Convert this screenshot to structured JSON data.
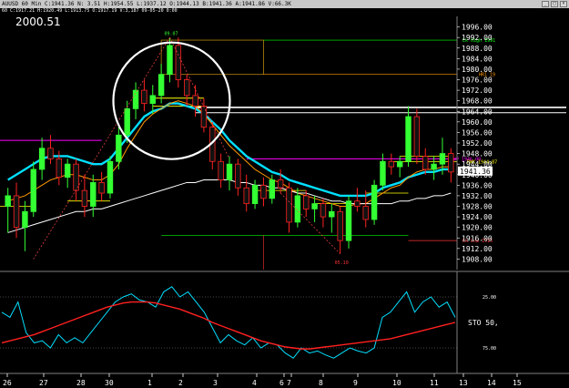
{
  "window": {
    "title": "AUUSD 60 Min  C:1941.36  N:  3.51  H:1954.55  L:1937.12  O:1944.13  B:1941.36  A:1941.86  V:66.3K"
  },
  "info_line": "60  C:1917.21  H:1920.49  L:1913.75  O:1917.19  V:3,187  09-05-20  0:00",
  "current_price_label": "2000.51",
  "chart_data": [
    {
      "type": "candlestick",
      "title": "",
      "y_axis": {
        "range": [
          1904,
          2000
        ],
        "ticks": [
          1908,
          1912,
          1916,
          1920,
          1924,
          1928,
          1932,
          1936,
          1940,
          1944,
          1948,
          1952,
          1956,
          1960,
          1964,
          1968,
          1972,
          1976,
          1980,
          1984,
          1988,
          1992,
          1996
        ],
        "tick_labels": [
          "1908.00",
          "1912.00",
          "1916.00",
          "1920.00",
          "1924.00",
          "1928.00",
          "1932.00",
          "1936.00",
          "1940.00",
          "1944.00",
          "1948.00",
          "1952.00",
          "1956.00",
          "1960.00",
          "1964.00",
          "1968.00",
          "1972.00",
          "1976.00",
          "1980.00",
          "1984.00",
          "1988.00",
          "1992.00",
          "1996.00"
        ],
        "last_price_tag": "1941.36"
      },
      "x_axis": {
        "tick_labels": [
          "26",
          "27",
          "28",
          "30",
          "1",
          "2",
          "3",
          "4",
          "6",
          "7",
          "8",
          "9",
          "10",
          "11",
          "13",
          "14",
          "15"
        ]
      },
      "candles": [
        {
          "o": 1928,
          "h": 1935,
          "l": 1918,
          "c": 1932
        },
        {
          "o": 1932,
          "h": 1937,
          "l": 1916,
          "c": 1920
        },
        {
          "o": 1920,
          "h": 1930,
          "l": 1911,
          "c": 1926
        },
        {
          "o": 1926,
          "h": 1945,
          "l": 1924,
          "c": 1942
        },
        {
          "o": 1942,
          "h": 1954,
          "l": 1938,
          "c": 1950
        },
        {
          "o": 1950,
          "h": 1955,
          "l": 1944,
          "c": 1946
        },
        {
          "o": 1946,
          "h": 1949,
          "l": 1936,
          "c": 1939
        },
        {
          "o": 1939,
          "h": 1946,
          "l": 1935,
          "c": 1944
        },
        {
          "o": 1944,
          "h": 1946,
          "l": 1930,
          "c": 1934
        },
        {
          "o": 1934,
          "h": 1940,
          "l": 1924,
          "c": 1928
        },
        {
          "o": 1928,
          "h": 1940,
          "l": 1924,
          "c": 1937
        },
        {
          "o": 1937,
          "h": 1941,
          "l": 1930,
          "c": 1933
        },
        {
          "o": 1933,
          "h": 1947,
          "l": 1931,
          "c": 1945
        },
        {
          "o": 1945,
          "h": 1958,
          "l": 1942,
          "c": 1955
        },
        {
          "o": 1955,
          "h": 1968,
          "l": 1952,
          "c": 1965
        },
        {
          "o": 1965,
          "h": 1975,
          "l": 1961,
          "c": 1972
        },
        {
          "o": 1972,
          "h": 1976,
          "l": 1964,
          "c": 1967
        },
        {
          "o": 1967,
          "h": 1974,
          "l": 1963,
          "c": 1970
        },
        {
          "o": 1970,
          "h": 1982,
          "l": 1967,
          "c": 1978
        },
        {
          "o": 1978,
          "h": 1992,
          "l": 1975,
          "c": 1989
        },
        {
          "o": 1989,
          "h": 1992,
          "l": 1973,
          "c": 1976
        },
        {
          "o": 1976,
          "h": 1978,
          "l": 1966,
          "c": 1970
        },
        {
          "o": 1970,
          "h": 1974,
          "l": 1962,
          "c": 1966
        },
        {
          "o": 1966,
          "h": 1969,
          "l": 1956,
          "c": 1958
        },
        {
          "o": 1958,
          "h": 1960,
          "l": 1942,
          "c": 1945
        },
        {
          "o": 1945,
          "h": 1948,
          "l": 1935,
          "c": 1938
        },
        {
          "o": 1938,
          "h": 1947,
          "l": 1934,
          "c": 1944
        },
        {
          "o": 1944,
          "h": 1946,
          "l": 1932,
          "c": 1935
        },
        {
          "o": 1935,
          "h": 1940,
          "l": 1926,
          "c": 1929
        },
        {
          "o": 1929,
          "h": 1938,
          "l": 1927,
          "c": 1936
        },
        {
          "o": 1936,
          "h": 1939,
          "l": 1928,
          "c": 1931
        },
        {
          "o": 1931,
          "h": 1940,
          "l": 1929,
          "c": 1938
        },
        {
          "o": 1938,
          "h": 1942,
          "l": 1933,
          "c": 1935
        },
        {
          "o": 1935,
          "h": 1937,
          "l": 1918,
          "c": 1922
        },
        {
          "o": 1922,
          "h": 1935,
          "l": 1920,
          "c": 1932
        },
        {
          "o": 1932,
          "h": 1934,
          "l": 1924,
          "c": 1927
        },
        {
          "o": 1927,
          "h": 1932,
          "l": 1922,
          "c": 1929
        },
        {
          "o": 1929,
          "h": 1931,
          "l": 1920,
          "c": 1924
        },
        {
          "o": 1924,
          "h": 1929,
          "l": 1918,
          "c": 1926
        },
        {
          "o": 1926,
          "h": 1928,
          "l": 1910,
          "c": 1915
        },
        {
          "o": 1915,
          "h": 1932,
          "l": 1912,
          "c": 1930
        },
        {
          "o": 1930,
          "h": 1935,
          "l": 1926,
          "c": 1928
        },
        {
          "o": 1928,
          "h": 1934,
          "l": 1920,
          "c": 1923
        },
        {
          "o": 1923,
          "h": 1938,
          "l": 1921,
          "c": 1936
        },
        {
          "o": 1936,
          "h": 1948,
          "l": 1934,
          "c": 1945
        },
        {
          "o": 1945,
          "h": 1948,
          "l": 1940,
          "c": 1943
        },
        {
          "o": 1943,
          "h": 1947,
          "l": 1939,
          "c": 1945
        },
        {
          "o": 1945,
          "h": 1966,
          "l": 1943,
          "c": 1962
        },
        {
          "o": 1962,
          "h": 1965,
          "l": 1944,
          "c": 1947
        },
        {
          "o": 1947,
          "h": 1950,
          "l": 1940,
          "c": 1942
        },
        {
          "o": 1942,
          "h": 1947,
          "l": 1938,
          "c": 1944
        },
        {
          "o": 1944,
          "h": 1954,
          "l": 1940,
          "c": 1948
        },
        {
          "o": 1948,
          "h": 1950,
          "l": 1937,
          "c": 1941
        }
      ],
      "moving_averages": [
        {
          "color": "#00e0ff",
          "values": [
            1938,
            1940,
            1942,
            1944,
            1946,
            1947,
            1947,
            1947,
            1946,
            1945,
            1944,
            1944,
            1946,
            1950,
            1954,
            1958,
            1962,
            1964,
            1965,
            1967,
            1967,
            1966,
            1965,
            1963,
            1960,
            1957,
            1953,
            1950,
            1947,
            1945,
            1943,
            1941,
            1940,
            1938,
            1937,
            1936,
            1935,
            1934,
            1933,
            1932,
            1932,
            1932,
            1932,
            1933,
            1935,
            1936,
            1937,
            1939,
            1940,
            1941,
            1941,
            1942,
            1942
          ]
        },
        {
          "color": "#ff9900",
          "values": [
            1930,
            1931,
            1932,
            1934,
            1936,
            1938,
            1939,
            1940,
            1940,
            1939,
            1938,
            1938,
            1940,
            1944,
            1950,
            1955,
            1960,
            1963,
            1965,
            1967,
            1968,
            1967,
            1966,
            1963,
            1959,
            1955,
            1951,
            1948,
            1945,
            1942,
            1940,
            1938,
            1937,
            1935,
            1933,
            1932,
            1931,
            1930,
            1929,
            1928,
            1928,
            1929,
            1929,
            1931,
            1933,
            1935,
            1936,
            1939,
            1941,
            1942,
            1942,
            1943,
            1943
          ]
        },
        {
          "color": "#ffffff",
          "values": [
            1918,
            1919,
            1920,
            1921,
            1922,
            1923,
            1924,
            1925,
            1926,
            1926,
            1927,
            1927,
            1928,
            1929,
            1930,
            1931,
            1932,
            1933,
            1934,
            1935,
            1936,
            1937,
            1937,
            1938,
            1938,
            1938,
            1938,
            1937,
            1937,
            1936,
            1936,
            1935,
            1935,
            1934,
            1933,
            1933,
            1932,
            1931,
            1930,
            1930,
            1929,
            1929,
            1929,
            1929,
            1929,
            1929,
            1930,
            1930,
            1931,
            1931,
            1932,
            1932,
            1933
          ]
        }
      ],
      "levels": [
        {
          "label": "Lk High 1991",
          "value": 1991,
          "color": "#00ff00"
        },
        {
          "label": "HR1 19",
          "value": 1978,
          "color": "#ff9900"
        },
        {
          "label": "WP 1946.00",
          "value": 1946,
          "color": "#ff00ff"
        },
        {
          "label": "RWK 1944.87",
          "value": 1944.87,
          "color": "#ffff00"
        },
        {
          "label": "Lk Low 1915",
          "value": 1915,
          "color": "#ff3333"
        }
      ],
      "annotations": [
        "09.07",
        "05.10"
      ]
    },
    {
      "type": "line",
      "title": "",
      "indicator_label": "STO  50,",
      "y_axis": {
        "tick_labels": [
          "25.00",
          "50.",
          "75.00"
        ]
      },
      "series": [
        {
          "color": "#00e0ff",
          "values": [
            40,
            45,
            30,
            60,
            70,
            68,
            75,
            62,
            70,
            65,
            70,
            60,
            50,
            40,
            30,
            25,
            22,
            28,
            30,
            35,
            20,
            15,
            25,
            20,
            30,
            40,
            55,
            70,
            62,
            68,
            72,
            65,
            75,
            70,
            72,
            80,
            85,
            75,
            80,
            78,
            82,
            85,
            80,
            75,
            78,
            80,
            75,
            45,
            40,
            30,
            20,
            40,
            30,
            25,
            35,
            30,
            45
          ]
        },
        {
          "color": "#ff2020",
          "values": [
            70,
            68,
            66,
            64,
            62,
            59,
            56,
            53,
            50,
            47,
            44,
            41,
            38,
            35,
            33,
            31,
            30,
            30,
            30,
            31,
            33,
            35,
            37,
            40,
            43,
            46,
            50,
            53,
            56,
            59,
            62,
            65,
            68,
            70,
            72,
            74,
            75,
            76,
            76,
            75,
            74,
            73,
            72,
            71,
            70,
            69,
            68,
            67,
            66,
            64,
            62,
            60,
            58,
            56,
            54,
            52,
            50
          ]
        }
      ]
    }
  ]
}
